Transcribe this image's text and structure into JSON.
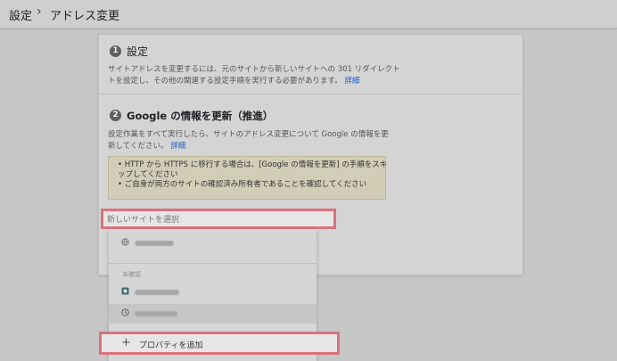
{
  "breadcrumb": {
    "root": "設定",
    "separator": "›",
    "current": "アドレス変更"
  },
  "step1": {
    "number": "1",
    "title": "設定",
    "line1": "サイトアドレスを変更するには、元のサイトから新しいサイトへの 301 リダイレクト",
    "line2": "トを設定し、その他の関連する設定手順を実行する必要があります。",
    "link": "詳細"
  },
  "step2": {
    "number": "2",
    "title": "Google の情報を更新（推進）",
    "line1": "設定作業をすべて実行したら、サイトのアドレス変更について Google の情報を更",
    "line2": "新してください。",
    "link": "詳細"
  },
  "notice": {
    "line1": "• HTTP から HTTPS に移行する場合は、[Google の情報を更新] の手順をスキ",
    "line2": "ップしてください",
    "line3": "• ご自身が両方のサイトの確認済み所有者であることを確認してください"
  },
  "site_select": {
    "placeholder": "新しいサイトを選択",
    "value": ""
  },
  "dropdown": {
    "section_label": "未確認",
    "items": [
      {
        "icon": "globe-icon"
      },
      {
        "icon": "site-favicon-icon"
      },
      {
        "icon": "clock-icon"
      }
    ],
    "add_property": {
      "icon": "plus-icon",
      "label": "プロパティを追加"
    }
  }
}
